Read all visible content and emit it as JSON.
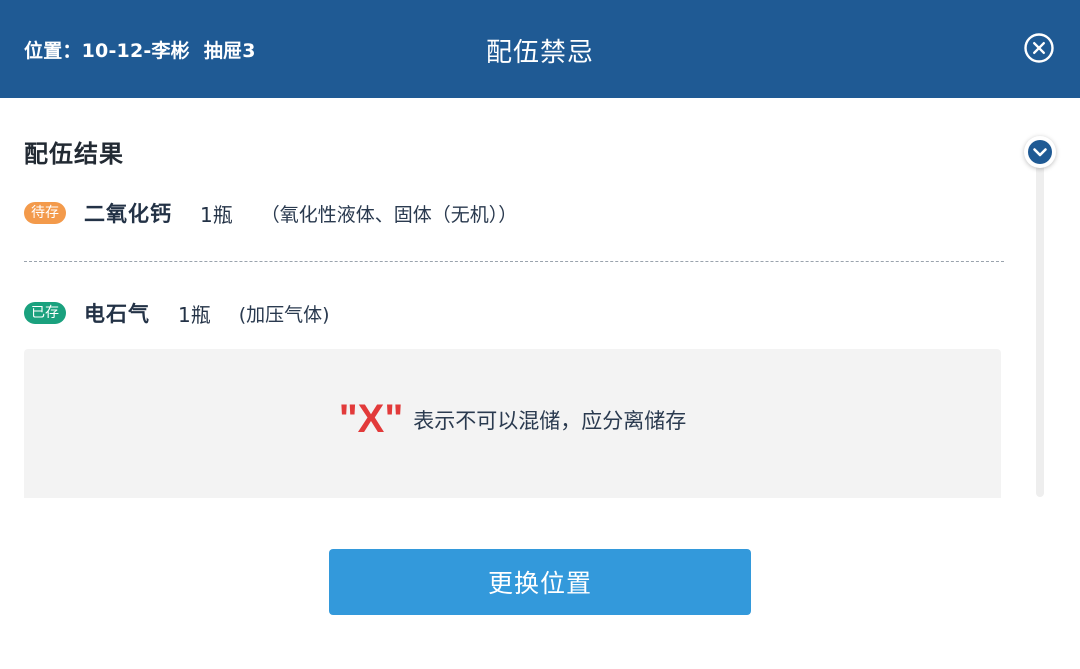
{
  "header": {
    "location": "位置：10-12-李彬",
    "drawer": "抽屉3",
    "title": "配伍禁忌",
    "close_icon": "close-circle-icon",
    "background": "#1f5a94"
  },
  "result": {
    "section_title": "配伍结果",
    "pending": {
      "badge": "待存",
      "badge_color": "#f39a4b",
      "name": "二氧化钙",
      "quantity": "1瓶",
      "category": "（氧化性液体、固体（无机））"
    },
    "stored": {
      "badge": "已存",
      "badge_color": "#1aa17e",
      "name": "电石气",
      "quantity": "1瓶",
      "category": "(加压气体)"
    },
    "legend": {
      "symbol": "\"X\"",
      "symbol_color": "#e23a3a",
      "text": "表示不可以混储，应分离储存"
    }
  },
  "scroll": {
    "handle_icon": "chevron-down-icon"
  },
  "footer": {
    "action_label": "更换位置",
    "action_color": "#3399db"
  }
}
